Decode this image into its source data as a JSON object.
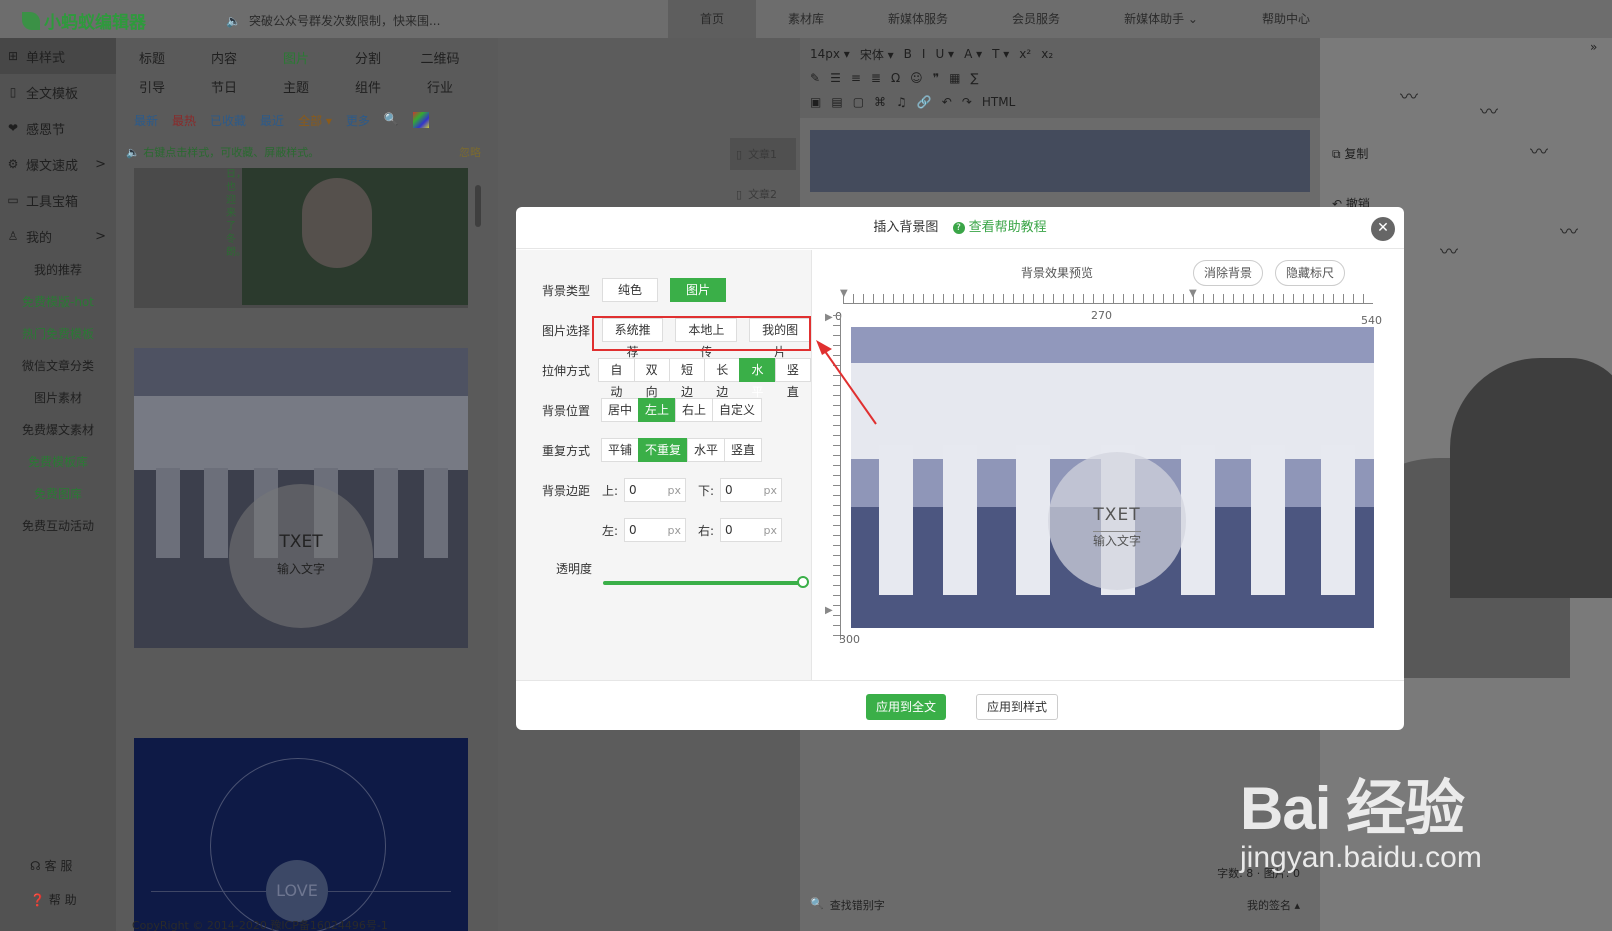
{
  "app": {
    "logo": "小蚂蚁编辑器"
  },
  "notice": "突破公众号群发次数限制，快来围...",
  "top_nav": [
    "首页",
    "素材库",
    "新媒体服务",
    "会员服务",
    "新媒体助手 ⌄",
    "帮助中心"
  ],
  "left_nav": {
    "main": [
      {
        "icon": "grid-icon",
        "glyph": "⊞",
        "label": "单样式",
        "arrow": ""
      },
      {
        "icon": "template-icon",
        "glyph": "▯",
        "label": "全文模板",
        "arrow": ""
      },
      {
        "icon": "heart-icon",
        "glyph": "❤",
        "label": "感恩节",
        "arrow": ""
      },
      {
        "icon": "bolt-icon",
        "glyph": "⚙",
        "label": "爆文速成",
        "arrow": ">"
      },
      {
        "icon": "toolbox-icon",
        "glyph": "▭",
        "label": "工具宝箱",
        "arrow": ""
      },
      {
        "icon": "user-icon",
        "glyph": "♙",
        "label": "我的",
        "arrow": ">"
      }
    ],
    "sub": [
      "我的推荐",
      "免费模版-hot",
      "热门免费模板",
      "微信文章分类",
      "图片素材",
      "免费爆文素材",
      "免费模板库",
      "免费图库",
      "免费互动活动"
    ],
    "service": "客 服",
    "help": "帮 助"
  },
  "categories": {
    "row1": [
      "标题",
      "内容",
      "图片",
      "分割",
      "二维码"
    ],
    "row2": [
      "引导",
      "节日",
      "主题",
      "组件",
      "行业"
    ]
  },
  "filters": {
    "latest": "最新",
    "hot": "最热",
    "fav": "已收藏",
    "recent": "最近",
    "all": "全部 ▾",
    "more": "更多"
  },
  "hint": "右键点击样式，可收藏、屏蔽样式。",
  "ignore": "忽略",
  "cards": {
    "card1_vertical": "日，也迎来了冬朗。",
    "card2_title": "TXET",
    "card2_sub": "输入文字",
    "card3_text": "LOVE"
  },
  "copyright": "CopyRight © 2014-2020 豫ICP备16024496号-1",
  "articles": [
    "文章1",
    "文章2"
  ],
  "editor": {
    "toolbar_row1": [
      "14px ▾",
      "宋体 ▾",
      "B",
      "I",
      "U ▾",
      "A ▾",
      "T ▾",
      "x²",
      "x₂"
    ],
    "toolbar_row2": [
      "✎",
      "☰",
      "≡",
      "≣",
      "Ω",
      "☺",
      "❞",
      "▦",
      "∑"
    ],
    "toolbar_row3": [
      "▣",
      "▤",
      "▢",
      "⌘",
      "♫",
      "🔗",
      "↶",
      "↷",
      "HTML"
    ],
    "find_typo": "查找错别字",
    "signature": "我的签名 ▴",
    "word_count": "字数: 8 · 图片: 0"
  },
  "side_actions": {
    "copy": "复制",
    "undo": "撤销"
  },
  "watermark": {
    "brand": "Bai 经验",
    "url": "jingyan.baidu.com"
  },
  "dialog": {
    "title": "插入背景图",
    "help": "查看帮助教程",
    "bg_type_label": "背景类型",
    "bg_type_options": [
      "纯色",
      "图片"
    ],
    "bg_type_selected": 1,
    "img_select_label": "图片选择",
    "img_select_options": [
      "系统推荐",
      "本地上传",
      "我的图片"
    ],
    "stretch_label": "拉伸方式",
    "stretch_options": [
      "自动",
      "双向",
      "短边",
      "长边",
      "水平",
      "竖直"
    ],
    "stretch_selected": 4,
    "position_label": "背景位置",
    "position_options": [
      "居中",
      "左上",
      "右上",
      "自定义"
    ],
    "position_selected": 1,
    "repeat_label": "重复方式",
    "repeat_options": [
      "平铺",
      "不重复",
      "水平",
      "竖直"
    ],
    "repeat_selected": 1,
    "margin_label": "背景边距",
    "margin_top_label": "上:",
    "margin_bottom_label": "下:",
    "margin_left_label": "左:",
    "margin_right_label": "右:",
    "margin_top": "0",
    "margin_bottom": "0",
    "margin_left": "0",
    "margin_right": "0",
    "unit": "px",
    "opacity_label": "透明度",
    "opacity": 1.0,
    "preview_title": "背景效果预览",
    "clear_bg": "消除背景",
    "hide_ruler": "隐藏标尺",
    "ruler": {
      "x0": "0",
      "xmid": "270",
      "xmax": "540",
      "ymax": "300"
    },
    "preview_text": "TXET",
    "preview_sub": "输入文字",
    "apply_all": "应用到全文",
    "apply_style": "应用到样式"
  },
  "colors": {
    "accent": "#3aaf48",
    "annotation_red": "#e03030"
  }
}
